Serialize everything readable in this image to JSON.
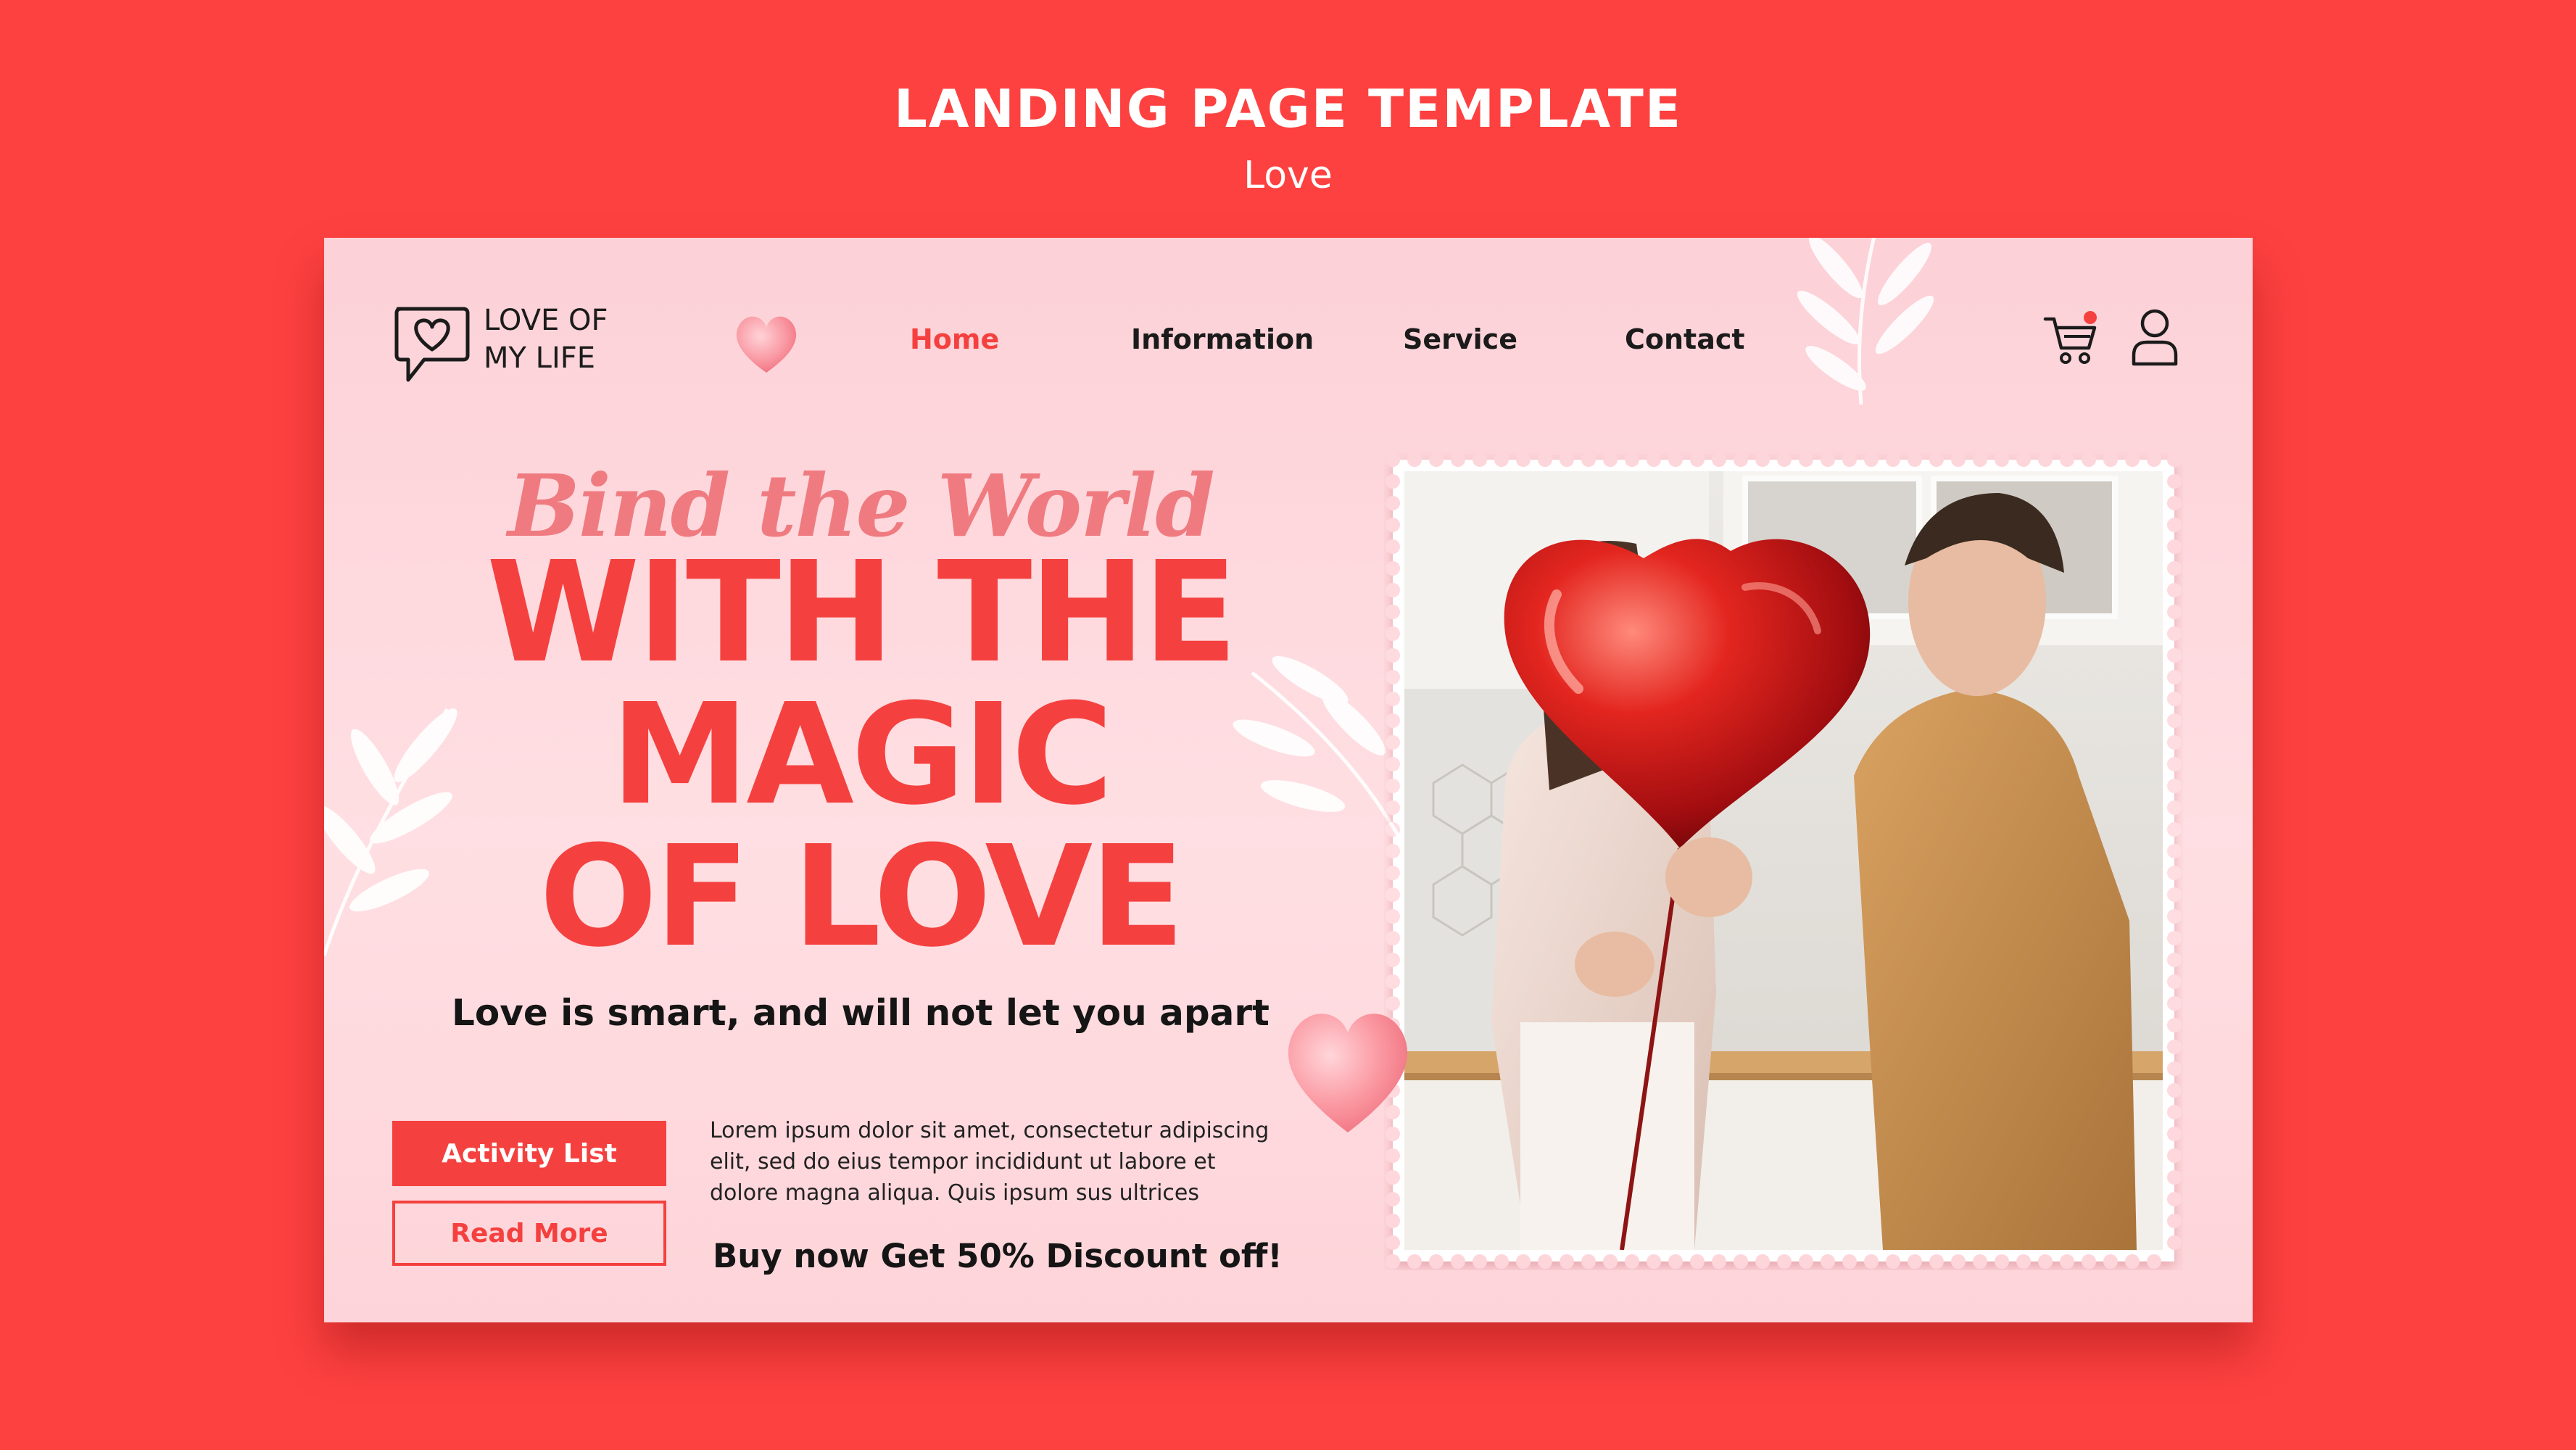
{
  "banner": {
    "title": "LANDING PAGE TEMPLATE",
    "subtitle": "Love"
  },
  "brand": {
    "line1": "LOVE OF",
    "line2": "MY LIFE",
    "icon": "heart-chat-icon"
  },
  "nav": {
    "items": [
      {
        "label": "Home",
        "active": true
      },
      {
        "label": "Information",
        "active": false
      },
      {
        "label": "Service",
        "active": false
      },
      {
        "label": "Contact",
        "active": false
      }
    ],
    "cart_icon": "cart-icon",
    "user_icon": "user-icon"
  },
  "hero": {
    "script": "Bind the World",
    "headline": [
      "WITH THE",
      "MAGIC",
      "OF LOVE"
    ],
    "tagline": "Love is smart, and will not let you apart",
    "primary_button": "Activity List",
    "secondary_button": "Read More",
    "description": "Lorem ipsum dolor sit amet, consectetur adipiscing elit, sed do eius tempor incididunt ut labore et dolore magna aliqua. Quis ipsum sus ultrices",
    "promo": "Buy now Get 50% Discount off!"
  },
  "colors": {
    "accent": "#f4413f",
    "background": "#fd4140",
    "card": "#fcd6db",
    "script": "#ef7b80"
  }
}
